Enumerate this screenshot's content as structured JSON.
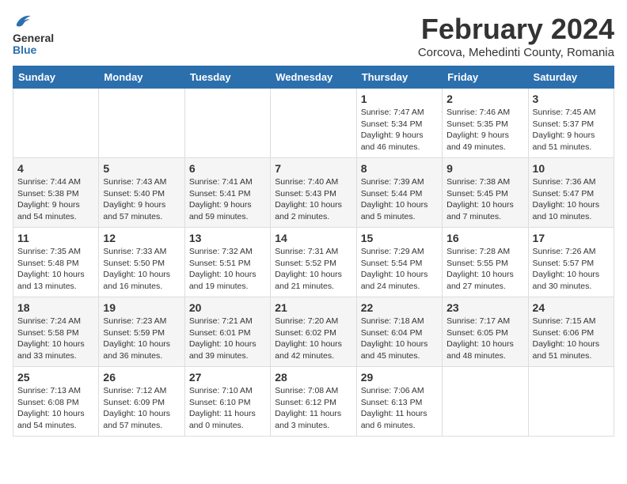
{
  "logo": {
    "general": "General",
    "blue": "Blue"
  },
  "title": "February 2024",
  "subtitle": "Corcova, Mehedinti County, Romania",
  "headers": [
    "Sunday",
    "Monday",
    "Tuesday",
    "Wednesday",
    "Thursday",
    "Friday",
    "Saturday"
  ],
  "weeks": [
    [
      {
        "day": "",
        "info": ""
      },
      {
        "day": "",
        "info": ""
      },
      {
        "day": "",
        "info": ""
      },
      {
        "day": "",
        "info": ""
      },
      {
        "day": "1",
        "info": "Sunrise: 7:47 AM\nSunset: 5:34 PM\nDaylight: 9 hours\nand 46 minutes."
      },
      {
        "day": "2",
        "info": "Sunrise: 7:46 AM\nSunset: 5:35 PM\nDaylight: 9 hours\nand 49 minutes."
      },
      {
        "day": "3",
        "info": "Sunrise: 7:45 AM\nSunset: 5:37 PM\nDaylight: 9 hours\nand 51 minutes."
      }
    ],
    [
      {
        "day": "4",
        "info": "Sunrise: 7:44 AM\nSunset: 5:38 PM\nDaylight: 9 hours\nand 54 minutes."
      },
      {
        "day": "5",
        "info": "Sunrise: 7:43 AM\nSunset: 5:40 PM\nDaylight: 9 hours\nand 57 minutes."
      },
      {
        "day": "6",
        "info": "Sunrise: 7:41 AM\nSunset: 5:41 PM\nDaylight: 9 hours\nand 59 minutes."
      },
      {
        "day": "7",
        "info": "Sunrise: 7:40 AM\nSunset: 5:43 PM\nDaylight: 10 hours\nand 2 minutes."
      },
      {
        "day": "8",
        "info": "Sunrise: 7:39 AM\nSunset: 5:44 PM\nDaylight: 10 hours\nand 5 minutes."
      },
      {
        "day": "9",
        "info": "Sunrise: 7:38 AM\nSunset: 5:45 PM\nDaylight: 10 hours\nand 7 minutes."
      },
      {
        "day": "10",
        "info": "Sunrise: 7:36 AM\nSunset: 5:47 PM\nDaylight: 10 hours\nand 10 minutes."
      }
    ],
    [
      {
        "day": "11",
        "info": "Sunrise: 7:35 AM\nSunset: 5:48 PM\nDaylight: 10 hours\nand 13 minutes."
      },
      {
        "day": "12",
        "info": "Sunrise: 7:33 AM\nSunset: 5:50 PM\nDaylight: 10 hours\nand 16 minutes."
      },
      {
        "day": "13",
        "info": "Sunrise: 7:32 AM\nSunset: 5:51 PM\nDaylight: 10 hours\nand 19 minutes."
      },
      {
        "day": "14",
        "info": "Sunrise: 7:31 AM\nSunset: 5:52 PM\nDaylight: 10 hours\nand 21 minutes."
      },
      {
        "day": "15",
        "info": "Sunrise: 7:29 AM\nSunset: 5:54 PM\nDaylight: 10 hours\nand 24 minutes."
      },
      {
        "day": "16",
        "info": "Sunrise: 7:28 AM\nSunset: 5:55 PM\nDaylight: 10 hours\nand 27 minutes."
      },
      {
        "day": "17",
        "info": "Sunrise: 7:26 AM\nSunset: 5:57 PM\nDaylight: 10 hours\nand 30 minutes."
      }
    ],
    [
      {
        "day": "18",
        "info": "Sunrise: 7:24 AM\nSunset: 5:58 PM\nDaylight: 10 hours\nand 33 minutes."
      },
      {
        "day": "19",
        "info": "Sunrise: 7:23 AM\nSunset: 5:59 PM\nDaylight: 10 hours\nand 36 minutes."
      },
      {
        "day": "20",
        "info": "Sunrise: 7:21 AM\nSunset: 6:01 PM\nDaylight: 10 hours\nand 39 minutes."
      },
      {
        "day": "21",
        "info": "Sunrise: 7:20 AM\nSunset: 6:02 PM\nDaylight: 10 hours\nand 42 minutes."
      },
      {
        "day": "22",
        "info": "Sunrise: 7:18 AM\nSunset: 6:04 PM\nDaylight: 10 hours\nand 45 minutes."
      },
      {
        "day": "23",
        "info": "Sunrise: 7:17 AM\nSunset: 6:05 PM\nDaylight: 10 hours\nand 48 minutes."
      },
      {
        "day": "24",
        "info": "Sunrise: 7:15 AM\nSunset: 6:06 PM\nDaylight: 10 hours\nand 51 minutes."
      }
    ],
    [
      {
        "day": "25",
        "info": "Sunrise: 7:13 AM\nSunset: 6:08 PM\nDaylight: 10 hours\nand 54 minutes."
      },
      {
        "day": "26",
        "info": "Sunrise: 7:12 AM\nSunset: 6:09 PM\nDaylight: 10 hours\nand 57 minutes."
      },
      {
        "day": "27",
        "info": "Sunrise: 7:10 AM\nSunset: 6:10 PM\nDaylight: 11 hours\nand 0 minutes."
      },
      {
        "day": "28",
        "info": "Sunrise: 7:08 AM\nSunset: 6:12 PM\nDaylight: 11 hours\nand 3 minutes."
      },
      {
        "day": "29",
        "info": "Sunrise: 7:06 AM\nSunset: 6:13 PM\nDaylight: 11 hours\nand 6 minutes."
      },
      {
        "day": "",
        "info": ""
      },
      {
        "day": "",
        "info": ""
      }
    ]
  ]
}
